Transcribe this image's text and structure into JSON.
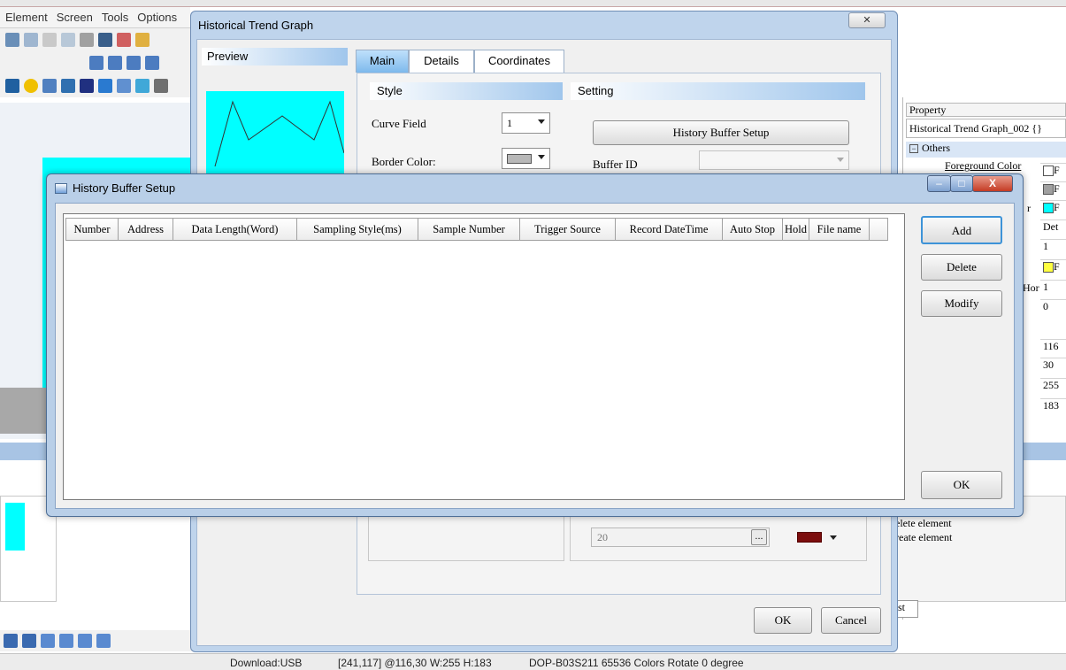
{
  "app": {
    "menu": [
      "Element",
      "Screen",
      "Tools",
      "Options"
    ]
  },
  "statusbar": {
    "download": "Download:USB",
    "position": "[241,117] @116,30 W:255 H:183",
    "device": "DOP-B03S211 65536 Colors Rotate 0 degree"
  },
  "property_panel": {
    "header": "Property",
    "object": "Historical Trend Graph_002 {}",
    "group": "Others",
    "foreground_color": "Foreground Color",
    "label_r": "r",
    "label_hor": "Hor",
    "values": [
      "F",
      "F",
      "F",
      "Det",
      "1",
      "F",
      "1",
      "0",
      "116",
      "30",
      "255",
      "183"
    ]
  },
  "output_panel": {
    "line1": "elete element",
    "line2": "reate element",
    "tab": "st"
  },
  "htg_dialog": {
    "title": "Historical Trend Graph",
    "preview_label": "Preview",
    "tabs": [
      "Main",
      "Details",
      "Coordinates"
    ],
    "style_header": "Style",
    "setting_header": "Setting",
    "curve_field_label": "Curve Field",
    "curve_field_value": "1",
    "border_color_label": "Border Color:",
    "history_buffer_button": "History Buffer Setup",
    "buffer_id_label": "Buffer ID",
    "sample_field_value": "20",
    "ellipsis": "...",
    "ok": "OK",
    "cancel": "Cancel",
    "colors": {
      "preview_bg": "#00ffff",
      "curve_line_color": "#7b0d0d"
    }
  },
  "hbs_dialog": {
    "title": "History Buffer Setup",
    "columns": [
      "Number",
      "Address",
      "Data Length(Word)",
      "Sampling Style(ms)",
      "Sample Number",
      "Trigger Source",
      "Record DateTime",
      "Auto Stop",
      "Hold",
      "File name"
    ],
    "buttons": {
      "add": "Add",
      "delete": "Delete",
      "modify": "Modify",
      "ok": "OK"
    },
    "close_glyph": "X"
  }
}
